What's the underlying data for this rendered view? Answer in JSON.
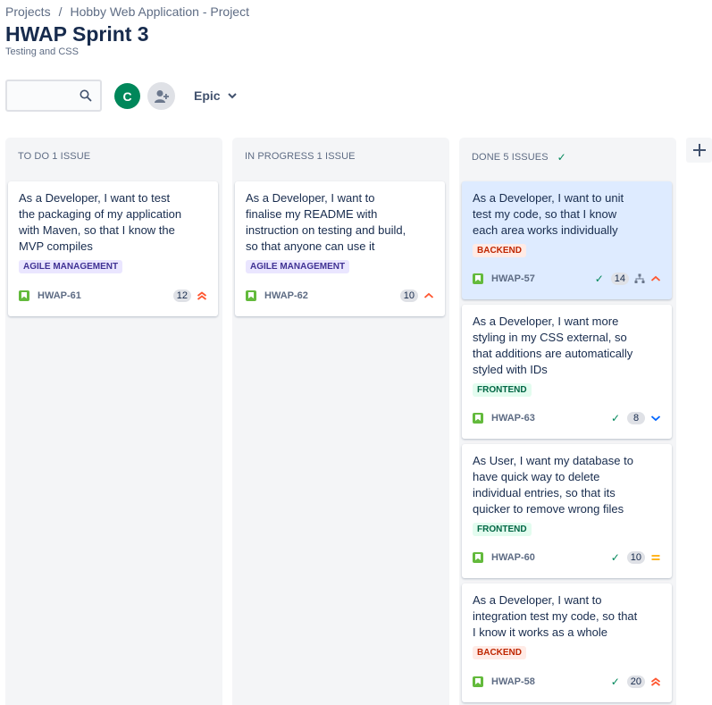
{
  "breadcrumb": {
    "projects": "Projects",
    "separator": "/",
    "project": "Hobby Web Application - Project"
  },
  "title": "HWAP Sprint 3",
  "subtitle": "Testing and CSS",
  "toolbar": {
    "search_value": "",
    "avatar_initial": "C",
    "epic_label": "Epic"
  },
  "colors": {
    "accent": "#0052cc",
    "avatar": "#00875a",
    "story": "#63ba3c",
    "selected_card": "#deebff"
  },
  "columns": [
    {
      "header": "TO DO 1 ISSUE",
      "cards": [
        {
          "title": "As a Developer, I want to test the packaging of my application with Maven, so that I know the MVP compiles",
          "label": "AGILE MANAGEMENT",
          "key": "HWAP-61",
          "points": "12",
          "priority": "highest-icon"
        }
      ]
    },
    {
      "header": "IN PROGRESS 1 ISSUE",
      "cards": [
        {
          "title": "As a Developer, I want to finalise my README with instruction on testing and build, so that anyone can use it",
          "label": "AGILE MANAGEMENT",
          "key": "HWAP-62",
          "points": "10",
          "priority": "high-icon"
        }
      ]
    },
    {
      "header": "DONE 5 ISSUES",
      "cards": [
        {
          "title": "As a Developer, I want to unit test my code, so that I know each area works individually",
          "label": "BACKEND",
          "key": "HWAP-57",
          "points": "14",
          "priority": "high-icon"
        },
        {
          "title": "As a Developer, I want more styling in my CSS external, so that additions are automatically styled with IDs",
          "label": "FRONTEND",
          "key": "HWAP-63",
          "points": "8",
          "priority": "low-icon"
        },
        {
          "title": "As User, I want my database to have quick way to delete individual entries, so that its quicker to remove wrong files",
          "label": "FRONTEND",
          "key": "HWAP-60",
          "points": "10",
          "priority": "medium-icon"
        },
        {
          "title": "As a Developer, I want to integration test my code, so that I know it works as a whole",
          "label": "BACKEND",
          "key": "HWAP-58",
          "points": "20",
          "priority": "highest-icon"
        }
      ]
    }
  ]
}
